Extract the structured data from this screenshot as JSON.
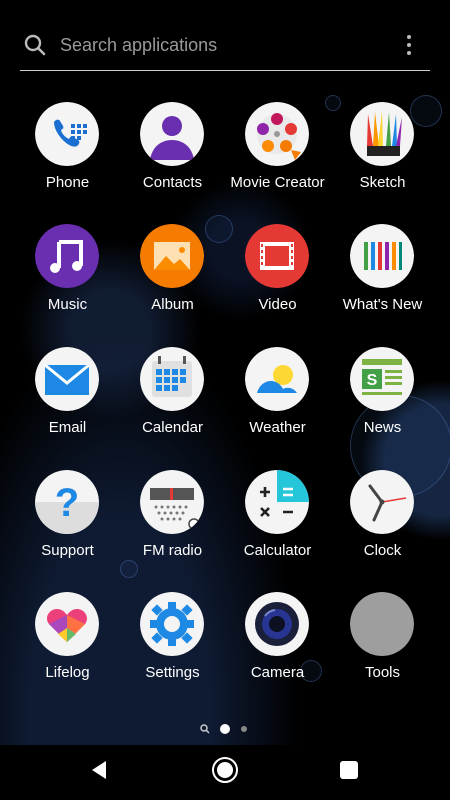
{
  "search": {
    "placeholder": "Search applications"
  },
  "apps": [
    {
      "label": "Phone"
    },
    {
      "label": "Contacts"
    },
    {
      "label": "Movie Creator"
    },
    {
      "label": "Sketch"
    },
    {
      "label": "Music"
    },
    {
      "label": "Album"
    },
    {
      "label": "Video"
    },
    {
      "label": "What's New"
    },
    {
      "label": "Email"
    },
    {
      "label": "Calendar"
    },
    {
      "label": "Weather"
    },
    {
      "label": "News"
    },
    {
      "label": "Support"
    },
    {
      "label": "FM radio"
    },
    {
      "label": "Calculator"
    },
    {
      "label": "Clock"
    },
    {
      "label": "Lifelog"
    },
    {
      "label": "Settings"
    },
    {
      "label": "Camera"
    },
    {
      "label": "Tools"
    }
  ],
  "pager": {
    "pages": 2,
    "current": 1
  },
  "colors": {
    "background": "#000000",
    "label": "#ffffff",
    "accent": "#1a6fd1"
  }
}
